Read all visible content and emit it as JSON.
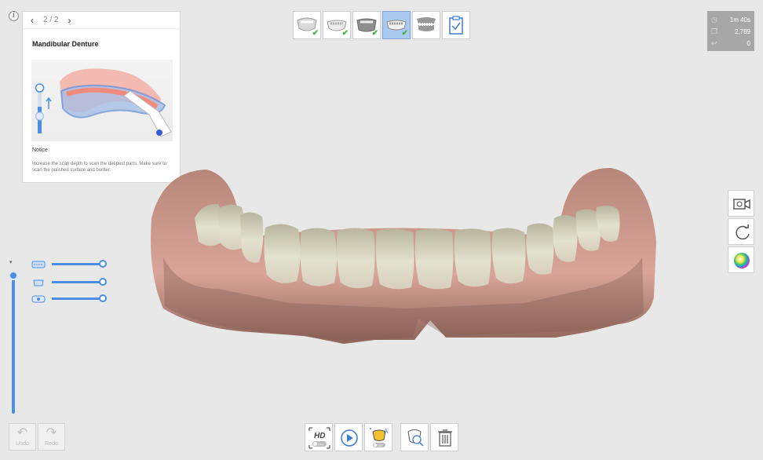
{
  "guide": {
    "page_indicator": "2 / 2",
    "prev_arrow": "‹",
    "next_arrow": "›",
    "title": "Mandibular Denture",
    "notice_heading": "Notice",
    "notice_body": "Increase the scan depth to scan the deepest parts. Make sure to scan the polished surface and border."
  },
  "info_button": "i",
  "steps": [
    {
      "name": "maxilla-scan",
      "completed": true,
      "active": false
    },
    {
      "name": "mandible-scan",
      "completed": true,
      "active": false
    },
    {
      "name": "maxillary-denture",
      "completed": true,
      "active": false
    },
    {
      "name": "mandibular-denture",
      "completed": true,
      "active": true
    },
    {
      "name": "occlusion",
      "completed": false,
      "active": false
    },
    {
      "name": "review",
      "completed": false,
      "active": false
    }
  ],
  "stats": {
    "time": "1m 40s",
    "count": "2,789",
    "third": "0"
  },
  "history": {
    "undo_label": "Undo",
    "redo_label": "Redo"
  },
  "bottom_toolbar": {
    "hd_label": "HD",
    "hd_toggle": "OFF",
    "ai_toggle": "OFF"
  },
  "colors": {
    "accent": "#4a8ee6",
    "active_step": "#a9c9ef",
    "check": "#3db33d",
    "stats_bg": "#a7a7a7"
  }
}
